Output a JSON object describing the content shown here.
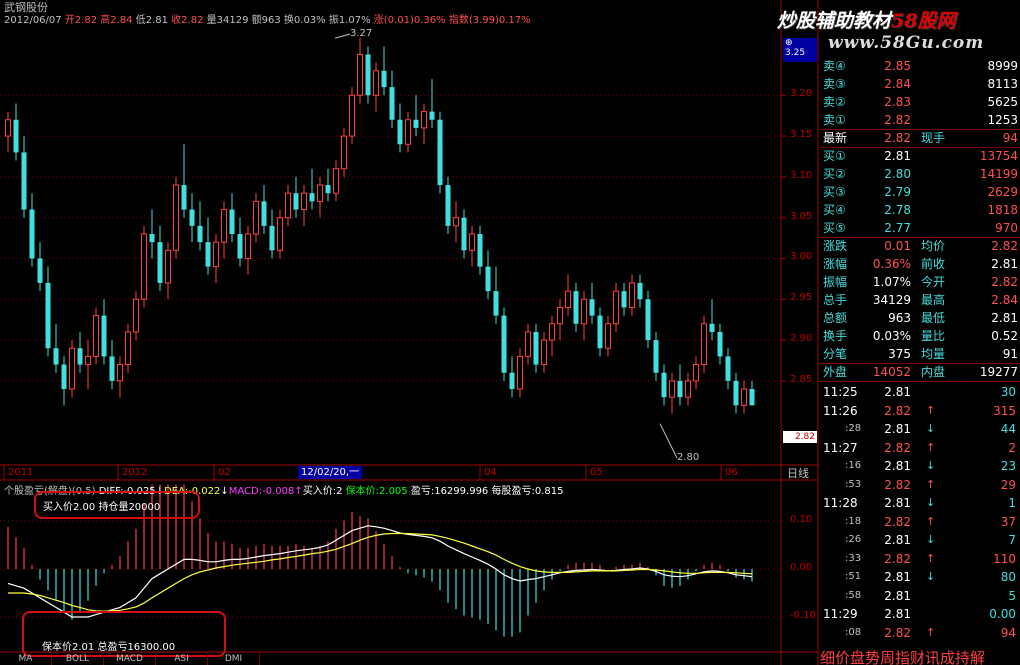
{
  "header": {
    "stock_name": "武钢股份",
    "quote_line": [
      {
        "text": "2012/06/07",
        "color": "#c0c0c0"
      },
      {
        "text": " 开2.82",
        "color": "#ff5050"
      },
      {
        "text": " 高2.84",
        "color": "#ff5050"
      },
      {
        "text": " 低2.81",
        "color": "#c0c0c0"
      },
      {
        "text": " 收2.82",
        "color": "#ff5050"
      },
      {
        "text": " 量34129",
        "color": "#c0c0c0"
      },
      {
        "text": " 额963",
        "color": "#c0c0c0"
      },
      {
        "text": " 换0.03%",
        "color": "#c0c0c0"
      },
      {
        "text": " 振1.07%",
        "color": "#c0c0c0"
      },
      {
        "text": " 涨(0.01)0.36%",
        "color": "#ff5050"
      },
      {
        "text": " 指数(3.99)0.17%",
        "color": "#ff5050"
      }
    ]
  },
  "price_axis": [
    "3.20",
    "3.15",
    "3.10",
    "3.05",
    "3.00",
    "2.95",
    "2.90",
    "2.85"
  ],
  "price_axis_top": "3.25",
  "current_price_tag": "2.82",
  "high_marker": "3.27",
  "low_marker": "2.80",
  "time_axis": [
    {
      "label": "2011",
      "x": 8
    },
    {
      "label": "2012",
      "x": 122
    },
    {
      "label": "02",
      "x": 218
    },
    {
      "label": "04",
      "x": 484
    },
    {
      "label": "05",
      "x": 590
    },
    {
      "label": "06",
      "x": 725
    }
  ],
  "cursor_date": "12/02/20,一",
  "period_label": "日线",
  "indicator": {
    "parts": [
      {
        "text": "个股盈亏(解盘)(0.5) ",
        "color": "#c0c0c0"
      },
      {
        "text": "DIFF:-0.025",
        "color": "#ffffff"
      },
      {
        "text": "↓",
        "color": "#ffffff"
      },
      {
        "text": "DEA:-0.022",
        "color": "#ffff40"
      },
      {
        "text": "↓",
        "color": "#ffffff"
      },
      {
        "text": "MACD:-0.008",
        "color": "#ff40ff"
      },
      {
        "text": "↑",
        "color": "#ff40ff"
      },
      {
        "text": "买入价:2 ",
        "color": "#ffffff"
      },
      {
        "text": "保本价:2.005 ",
        "color": "#00ff00"
      },
      {
        "text": "盈亏:16299.996 ",
        "color": "#ffffff"
      },
      {
        "text": "每股盈亏:0.815",
        "color": "#ffffff"
      }
    ],
    "axis": [
      "0.10",
      "0.00",
      "-0.10"
    ],
    "box1_line": "买入价2.00   持仓量20000",
    "box2_line": "保本价2.01   总盈亏16300.00"
  },
  "tabs": [
    "MA",
    "BOLL",
    "MACD",
    "ASI",
    "DMI"
  ],
  "banner": {
    "logo_part1": "炒股辅助教材",
    "logo_part2": "58股网",
    "url": "www.58Gu.com"
  },
  "sell_orders": [
    {
      "label": "卖④",
      "price": "2.85",
      "vol": "8999"
    },
    {
      "label": "卖③",
      "price": "2.84",
      "vol": "8113"
    },
    {
      "label": "卖②",
      "price": "2.83",
      "vol": "5625"
    },
    {
      "label": "卖①",
      "price": "2.82",
      "vol": "1253"
    }
  ],
  "latest": {
    "label": "最新",
    "price": "2.82",
    "label2": "现手",
    "vol": "94"
  },
  "buy_orders": [
    {
      "label": "买①",
      "price": "2.81",
      "vol": "13754",
      "pc": "#ffffff"
    },
    {
      "label": "买②",
      "price": "2.80",
      "vol": "14199",
      "pc": "#4dd"
    },
    {
      "label": "买③",
      "price": "2.79",
      "vol": "2629",
      "pc": "#4dd"
    },
    {
      "label": "买④",
      "price": "2.78",
      "vol": "1818",
      "pc": "#4dd"
    },
    {
      "label": "买⑤",
      "price": "2.77",
      "vol": "970",
      "pc": "#4dd"
    }
  ],
  "stats": [
    {
      "l1": "涨跌",
      "v1": "0.01",
      "c1": "#ff5050",
      "l2": "均价",
      "v2": "2.82",
      "c2": "#ff5050"
    },
    {
      "l1": "涨幅",
      "v1": "0.36%",
      "c1": "#ff5050",
      "l2": "前收",
      "v2": "2.81",
      "c2": "#ffffff"
    },
    {
      "l1": "振幅",
      "v1": "1.07%",
      "c1": "#ffffff",
      "l2": "今开",
      "v2": "2.82",
      "c2": "#ff5050"
    },
    {
      "l1": "总手",
      "v1": "34129",
      "c1": "#ffffff",
      "l2": "最高",
      "v2": "2.84",
      "c2": "#ff5050"
    },
    {
      "l1": "总额",
      "v1": "963",
      "c1": "#ffffff",
      "l2": "最低",
      "v2": "2.81",
      "c2": "#ffffff"
    },
    {
      "l1": "换手",
      "v1": "0.03%",
      "c1": "#ffffff",
      "l2": "量比",
      "v2": "0.52",
      "c2": "#ffffff"
    },
    {
      "l1": "分笔",
      "v1": "375",
      "c1": "#ffffff",
      "l2": "均量",
      "v2": "91",
      "c2": "#ffffff"
    }
  ],
  "outer_inner": {
    "l1": "外盘",
    "v1": "14052",
    "l2": "内盘",
    "v2": "19277"
  },
  "ticks": [
    {
      "time": "11:25",
      "sub": false,
      "price": "2.81",
      "pc": "#ffffff",
      "arrow": "",
      "vol": "30",
      "vc": "#4dd"
    },
    {
      "time": "11:26",
      "sub": false,
      "price": "2.82",
      "pc": "#ff5050",
      "arrow": "↑",
      "vol": "315",
      "vc": "#ff5050"
    },
    {
      "time": ":28",
      "sub": true,
      "price": "2.81",
      "pc": "#ffffff",
      "arrow": "↓",
      "vol": "44",
      "vc": "#4dd"
    },
    {
      "time": "11:27",
      "sub": false,
      "price": "2.82",
      "pc": "#ff5050",
      "arrow": "↑",
      "vol": "2",
      "vc": "#ff5050"
    },
    {
      "time": ":16",
      "sub": true,
      "price": "2.81",
      "pc": "#ffffff",
      "arrow": "↓",
      "vol": "23",
      "vc": "#4dd"
    },
    {
      "time": ":53",
      "sub": true,
      "price": "2.82",
      "pc": "#ff5050",
      "arrow": "↑",
      "vol": "29",
      "vc": "#ff5050"
    },
    {
      "time": "11:28",
      "sub": false,
      "price": "2.81",
      "pc": "#ffffff",
      "arrow": "↓",
      "vol": "1",
      "vc": "#4dd"
    },
    {
      "time": ":18",
      "sub": true,
      "price": "2.82",
      "pc": "#ff5050",
      "arrow": "↑",
      "vol": "37",
      "vc": "#ff5050"
    },
    {
      "time": ":26",
      "sub": true,
      "price": "2.81",
      "pc": "#ffffff",
      "arrow": "↓",
      "vol": "7",
      "vc": "#4dd"
    },
    {
      "time": ":33",
      "sub": true,
      "price": "2.82",
      "pc": "#ff5050",
      "arrow": "↑",
      "vol": "110",
      "vc": "#ff5050"
    },
    {
      "time": ":51",
      "sub": true,
      "price": "2.81",
      "pc": "#ffffff",
      "arrow": "↓",
      "vol": "80",
      "vc": "#4dd"
    },
    {
      "time": ":58",
      "sub": true,
      "price": "2.81",
      "pc": "#ffffff",
      "arrow": "",
      "vol": "5",
      "vc": "#4dd"
    },
    {
      "time": "11:29",
      "sub": false,
      "price": "2.81",
      "pc": "#ffffff",
      "arrow": "",
      "vol": "0.00",
      "vc": "#4dd"
    },
    {
      "time": ":08",
      "sub": true,
      "price": "2.82",
      "pc": "#ff5050",
      "arrow": "↑",
      "vol": "94",
      "vc": "#ff5050"
    }
  ],
  "ticker_text": "细价盘势周指财讯成持解",
  "chart_data": {
    "type": "candlestick",
    "ylim": [
      2.78,
      3.28
    ],
    "candles": [
      [
        3.15,
        3.18,
        3.13,
        3.17
      ],
      [
        3.17,
        3.19,
        3.12,
        3.13
      ],
      [
        3.13,
        3.15,
        3.05,
        3.06
      ],
      [
        3.06,
        3.08,
        2.99,
        3.0
      ],
      [
        3.0,
        3.02,
        2.96,
        2.97
      ],
      [
        2.97,
        2.99,
        2.88,
        2.89
      ],
      [
        2.89,
        2.92,
        2.86,
        2.87
      ],
      [
        2.87,
        2.88,
        2.82,
        2.84
      ],
      [
        2.84,
        2.9,
        2.83,
        2.89
      ],
      [
        2.89,
        2.91,
        2.86,
        2.87
      ],
      [
        2.87,
        2.9,
        2.84,
        2.88
      ],
      [
        2.88,
        2.94,
        2.87,
        2.93
      ],
      [
        2.93,
        2.95,
        2.87,
        2.88
      ],
      [
        2.88,
        2.9,
        2.84,
        2.85
      ],
      [
        2.85,
        2.88,
        2.83,
        2.87
      ],
      [
        2.87,
        2.92,
        2.86,
        2.91
      ],
      [
        2.91,
        2.96,
        2.9,
        2.95
      ],
      [
        2.95,
        3.04,
        2.94,
        3.03
      ],
      [
        3.03,
        3.06,
        3.0,
        3.02
      ],
      [
        3.02,
        3.04,
        2.96,
        2.97
      ],
      [
        2.97,
        3.02,
        2.95,
        3.01
      ],
      [
        3.01,
        3.1,
        3.0,
        3.09
      ],
      [
        3.09,
        3.14,
        3.05,
        3.06
      ],
      [
        3.06,
        3.08,
        3.02,
        3.04
      ],
      [
        3.04,
        3.07,
        3.01,
        3.02
      ],
      [
        3.02,
        3.05,
        2.98,
        2.99
      ],
      [
        2.99,
        3.03,
        2.97,
        3.02
      ],
      [
        3.02,
        3.07,
        3.0,
        3.06
      ],
      [
        3.06,
        3.08,
        3.02,
        3.03
      ],
      [
        3.03,
        3.05,
        2.99,
        3.0
      ],
      [
        3.0,
        3.04,
        2.98,
        3.03
      ],
      [
        3.03,
        3.08,
        3.02,
        3.07
      ],
      [
        3.07,
        3.09,
        3.03,
        3.04
      ],
      [
        3.04,
        3.06,
        3.0,
        3.01
      ],
      [
        3.01,
        3.06,
        3.0,
        3.05
      ],
      [
        3.05,
        3.09,
        3.04,
        3.08
      ],
      [
        3.08,
        3.1,
        3.05,
        3.06
      ],
      [
        3.06,
        3.09,
        3.04,
        3.08
      ],
      [
        3.08,
        3.11,
        3.06,
        3.07
      ],
      [
        3.07,
        3.1,
        3.05,
        3.09
      ],
      [
        3.09,
        3.11,
        3.07,
        3.08
      ],
      [
        3.08,
        3.12,
        3.07,
        3.11
      ],
      [
        3.11,
        3.16,
        3.1,
        3.15
      ],
      [
        3.15,
        3.21,
        3.14,
        3.2
      ],
      [
        3.2,
        3.27,
        3.19,
        3.25
      ],
      [
        3.25,
        3.26,
        3.19,
        3.2
      ],
      [
        3.2,
        3.24,
        3.18,
        3.23
      ],
      [
        3.23,
        3.26,
        3.2,
        3.21
      ],
      [
        3.21,
        3.23,
        3.16,
        3.17
      ],
      [
        3.17,
        3.19,
        3.13,
        3.14
      ],
      [
        3.14,
        3.18,
        3.13,
        3.17
      ],
      [
        3.17,
        3.2,
        3.15,
        3.16
      ],
      [
        3.16,
        3.19,
        3.14,
        3.18
      ],
      [
        3.18,
        3.22,
        3.16,
        3.17
      ],
      [
        3.17,
        3.18,
        3.08,
        3.09
      ],
      [
        3.09,
        3.1,
        3.03,
        3.04
      ],
      [
        3.04,
        3.07,
        3.02,
        3.05
      ],
      [
        3.05,
        3.06,
        3.0,
        3.01
      ],
      [
        3.01,
        3.04,
        2.99,
        3.03
      ],
      [
        3.03,
        3.04,
        2.98,
        2.99
      ],
      [
        2.99,
        3.01,
        2.95,
        2.96
      ],
      [
        2.96,
        2.99,
        2.92,
        2.93
      ],
      [
        2.93,
        2.94,
        2.85,
        2.86
      ],
      [
        2.86,
        2.88,
        2.83,
        2.84
      ],
      [
        2.84,
        2.89,
        2.83,
        2.88
      ],
      [
        2.88,
        2.92,
        2.87,
        2.91
      ],
      [
        2.91,
        2.92,
        2.86,
        2.87
      ],
      [
        2.87,
        2.91,
        2.86,
        2.9
      ],
      [
        2.9,
        2.93,
        2.88,
        2.92
      ],
      [
        2.92,
        2.95,
        2.9,
        2.94
      ],
      [
        2.94,
        2.98,
        2.93,
        2.96
      ],
      [
        2.96,
        2.97,
        2.91,
        2.92
      ],
      [
        2.92,
        2.96,
        2.9,
        2.95
      ],
      [
        2.95,
        2.97,
        2.92,
        2.93
      ],
      [
        2.93,
        2.94,
        2.88,
        2.89
      ],
      [
        2.89,
        2.93,
        2.88,
        2.92
      ],
      [
        2.92,
        2.97,
        2.91,
        2.96
      ],
      [
        2.96,
        2.97,
        2.93,
        2.94
      ],
      [
        2.94,
        2.98,
        2.93,
        2.97
      ],
      [
        2.97,
        2.98,
        2.94,
        2.95
      ],
      [
        2.95,
        2.96,
        2.89,
        2.9
      ],
      [
        2.9,
        2.91,
        2.85,
        2.86
      ],
      [
        2.86,
        2.87,
        2.82,
        2.83
      ],
      [
        2.83,
        2.86,
        2.81,
        2.85
      ],
      [
        2.85,
        2.87,
        2.82,
        2.83
      ],
      [
        2.83,
        2.86,
        2.82,
        2.85
      ],
      [
        2.85,
        2.88,
        2.84,
        2.87
      ],
      [
        2.87,
        2.93,
        2.86,
        2.92
      ],
      [
        2.92,
        2.95,
        2.9,
        2.91
      ],
      [
        2.91,
        2.92,
        2.87,
        2.88
      ],
      [
        2.88,
        2.89,
        2.84,
        2.85
      ],
      [
        2.85,
        2.86,
        2.81,
        2.82
      ],
      [
        2.82,
        2.85,
        2.81,
        2.84
      ],
      [
        2.84,
        2.85,
        2.82,
        2.82
      ]
    ],
    "diff": [
      -0.03,
      -0.035,
      -0.04,
      -0.05,
      -0.06,
      -0.07,
      -0.08,
      -0.09,
      -0.1,
      -0.1,
      -0.1,
      -0.095,
      -0.09,
      -0.085,
      -0.08,
      -0.07,
      -0.06,
      -0.04,
      -0.02,
      -0.01,
      0.0,
      0.01,
      0.02,
      0.02,
      0.018,
      0.015,
      0.015,
      0.018,
      0.02,
      0.02,
      0.022,
      0.025,
      0.028,
      0.03,
      0.032,
      0.035,
      0.038,
      0.04,
      0.042,
      0.045,
      0.05,
      0.06,
      0.07,
      0.08,
      0.085,
      0.09,
      0.088,
      0.085,
      0.08,
      0.075,
      0.072,
      0.07,
      0.068,
      0.065,
      0.058,
      0.048,
      0.04,
      0.032,
      0.025,
      0.018,
      0.01,
      0.0,
      -0.012,
      -0.02,
      -0.025,
      -0.022,
      -0.02,
      -0.016,
      -0.012,
      -0.008,
      -0.005,
      -0.003,
      -0.002,
      -0.001,
      -0.002,
      -0.004,
      -0.003,
      -0.001,
      0.0,
      0.002,
      0.0,
      -0.005,
      -0.012,
      -0.015,
      -0.016,
      -0.014,
      -0.01,
      -0.006,
      -0.004,
      -0.005,
      -0.008,
      -0.012,
      -0.014,
      -0.016
    ],
    "dea": [
      -0.05,
      -0.05,
      -0.05,
      -0.052,
      -0.055,
      -0.06,
      -0.065,
      -0.07,
      -0.076,
      -0.08,
      -0.085,
      -0.087,
      -0.088,
      -0.087,
      -0.086,
      -0.083,
      -0.079,
      -0.071,
      -0.06,
      -0.05,
      -0.04,
      -0.03,
      -0.02,
      -0.012,
      -0.006,
      -0.002,
      0.002,
      0.005,
      0.008,
      0.01,
      0.012,
      0.014,
      0.016,
      0.019,
      0.021,
      0.024,
      0.026,
      0.029,
      0.032,
      0.034,
      0.037,
      0.041,
      0.047,
      0.053,
      0.06,
      0.066,
      0.07,
      0.073,
      0.074,
      0.074,
      0.074,
      0.073,
      0.072,
      0.071,
      0.068,
      0.064,
      0.059,
      0.054,
      0.048,
      0.042,
      0.036,
      0.029,
      0.02,
      0.012,
      0.005,
      0.0,
      -0.004,
      -0.006,
      -0.007,
      -0.007,
      -0.007,
      -0.006,
      -0.005,
      -0.004,
      -0.004,
      -0.004,
      -0.004,
      -0.003,
      -0.002,
      -0.001,
      -0.001,
      -0.002,
      -0.004,
      -0.006,
      -0.008,
      -0.009,
      -0.009,
      -0.008,
      -0.007,
      -0.007,
      -0.007,
      -0.008,
      -0.009,
      -0.01
    ]
  }
}
